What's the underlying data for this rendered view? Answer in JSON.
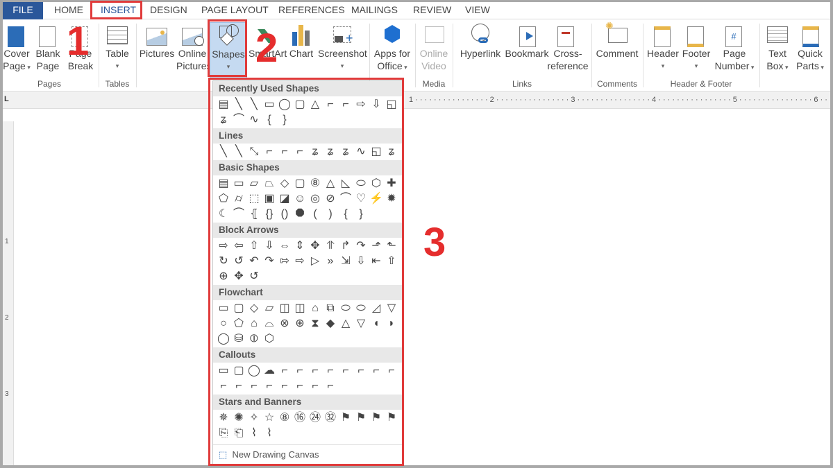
{
  "tabs": [
    "FILE",
    "HOME",
    "INSERT",
    "DESIGN",
    "PAGE LAYOUT",
    "REFERENCES",
    "MAILINGS",
    "REVIEW",
    "VIEW"
  ],
  "ribbon": {
    "cover": "Cover",
    "cover2": "Page",
    "blank": "Blank",
    "blank2": "Page",
    "break": "Page",
    "break2": "Break",
    "table": "Table",
    "pictures": "Pictures",
    "online": "Online",
    "online2": "Pictures",
    "shapes": "Shapes",
    "smartart": "SmartArt",
    "chart": "Chart",
    "screenshot": "Screenshot",
    "apps": "Apps for",
    "apps2": "Office",
    "video": "Online",
    "video2": "Video",
    "hyperlink": "Hyperlink",
    "bookmark": "Bookmark",
    "cross": "Cross-",
    "cross2": "reference",
    "comment": "Comment",
    "header": "Header",
    "footer": "Footer",
    "pagenum": "Page",
    "pagenum2": "Number",
    "textbox": "Text",
    "textbox2": "Box",
    "quick": "Quick",
    "quick2": "Parts"
  },
  "groups": {
    "pages": "Pages",
    "tables": "Tables",
    "media": "Media",
    "links": "Links",
    "comments": "Comments",
    "hf": "Header & Footer"
  },
  "ruler": {
    "h": "1 · · · · · · · · · · · · · · · · 2 · · · · · · · · · · · · · · · · 3 · · · · · · · · · · · · · · · · 4 · · · · · · · · · · · · · · · · 5 · · · · · · · · · · · · · · · · 6 · · ·",
    "v": [
      "1",
      "2",
      "3"
    ],
    "corner": "L"
  },
  "gallery": {
    "sections": [
      {
        "title": "Recently Used Shapes",
        "shapes": [
          "▤",
          "╲",
          "╲",
          "▭",
          "◯",
          "▢",
          "△",
          "⌐",
          "⌐",
          "⇨",
          "⇩",
          "◱",
          "ʑ",
          "⌒",
          "∿",
          "{",
          "}"
        ]
      },
      {
        "title": "Lines",
        "shapes": [
          "╲",
          "╲",
          "⤡",
          "⌐",
          "⌐",
          "⌐",
          "ʑ",
          "ʑ",
          "ʑ",
          "∿",
          "◱",
          "ʑ"
        ]
      },
      {
        "title": "Basic Shapes",
        "shapes": [
          "▤",
          "▭",
          "▱",
          "⏢",
          "◇",
          "▢",
          "⑧",
          "△",
          "◺",
          "⬭",
          "⬡",
          "✚",
          "⬠",
          "⌭",
          "⬚",
          "▣",
          "◪",
          "☺",
          "◎",
          "⊘",
          "⌒",
          "♡",
          "⚡",
          "✹",
          "☾",
          "⌒",
          "⦃",
          "{}",
          "()",
          "⯃",
          "(",
          ")",
          "{",
          "}"
        ]
      },
      {
        "title": "Block Arrows",
        "shapes": [
          "⇨",
          "⇦",
          "⇧",
          "⇩",
          "⇔",
          "⇕",
          "✥",
          "⥣",
          "↱",
          "↷",
          "⬏",
          "⬑",
          "↻",
          "↺",
          "↶",
          "↷",
          "⇰",
          "⇨",
          "▷",
          "»",
          "⇲",
          "⇩",
          "⇤",
          "⇧",
          "⊕",
          "✥",
          "↺"
        ]
      },
      {
        "title": "Flowchart",
        "shapes": [
          "▭",
          "▢",
          "◇",
          "▱",
          "◫",
          "◫",
          "⌂",
          "⧉",
          "⬭",
          "⬭",
          "◿",
          "▽",
          "○",
          "⬠",
          "⌂",
          "⌓",
          "⊗",
          "⊕",
          "⧗",
          "◆",
          "△",
          "▽",
          "◖",
          "◗",
          "◯",
          "⛁",
          "⦶",
          "⬡"
        ]
      },
      {
        "title": "Callouts",
        "shapes": [
          "▭",
          "▢",
          "◯",
          "☁",
          "⌐",
          "⌐",
          "⌐",
          "⌐",
          "⌐",
          "⌐",
          "⌐",
          "⌐",
          "⌐",
          "⌐",
          "⌐",
          "⌐",
          "⌐",
          "⌐",
          "⌐",
          "⌐"
        ]
      },
      {
        "title": "Stars and Banners",
        "shapes": [
          "✵",
          "✺",
          "✧",
          "☆",
          "⑧",
          "⑯",
          "㉔",
          "㉜",
          "⚑",
          "⚑",
          "⚑",
          "⚑",
          "⎘",
          "⎗",
          "⌇",
          "⌇"
        ]
      }
    ],
    "canvas": "New Drawing Canvas"
  },
  "annotations": [
    "1",
    "2",
    "3"
  ]
}
